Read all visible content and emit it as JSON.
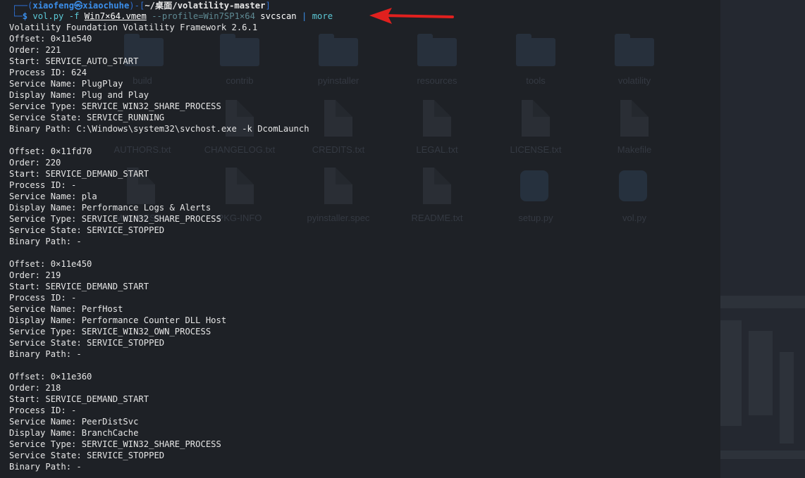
{
  "prompt": {
    "user": "xiaofeng",
    "at_symbol": "㉿",
    "host": "xiaochuhe",
    "path": "~/桌面/volatility-master",
    "symbol": "$",
    "cmd_prog": "vol.py",
    "cmd_flag": "-f",
    "cmd_file": "Win7×64.vmem",
    "cmd_profile": "--profile=Win7SP1×64",
    "cmd_plugin": "svcscan",
    "pipe": "|",
    "pipe_cmd": "more"
  },
  "output": {
    "header": "Volatility Foundation Volatility Framework 2.6.1",
    "services": [
      {
        "offset": "Offset: 0×11e540",
        "order": "Order: 221",
        "start": "Start: SERVICE_AUTO_START",
        "pid": "Process ID: 624",
        "name": "Service Name: PlugPlay",
        "display": "Display Name: Plug and Play",
        "type": "Service Type: SERVICE_WIN32_SHARE_PROCESS",
        "state": "Service State: SERVICE_RUNNING",
        "binary": "Binary Path: C:\\Windows\\system32\\svchost.exe -k DcomLaunch"
      },
      {
        "offset": "Offset: 0×11fd70",
        "order": "Order: 220",
        "start": "Start: SERVICE_DEMAND_START",
        "pid": "Process ID: -",
        "name": "Service Name: pla",
        "display": "Display Name: Performance Logs & Alerts",
        "type": "Service Type: SERVICE_WIN32_SHARE_PROCESS",
        "state": "Service State: SERVICE_STOPPED",
        "binary": "Binary Path: -"
      },
      {
        "offset": "Offset: 0×11e450",
        "order": "Order: 219",
        "start": "Start: SERVICE_DEMAND_START",
        "pid": "Process ID: -",
        "name": "Service Name: PerfHost",
        "display": "Display Name: Performance Counter DLL Host",
        "type": "Service Type: SERVICE_WIN32_OWN_PROCESS",
        "state": "Service State: SERVICE_STOPPED",
        "binary": "Binary Path: -"
      },
      {
        "offset": "Offset: 0×11e360",
        "order": "Order: 218",
        "start": "Start: SERVICE_DEMAND_START",
        "pid": "Process ID: -",
        "name": "Service Name: PeerDistSvc",
        "display": "Display Name: BranchCache",
        "type": "Service Type: SERVICE_WIN32_SHARE_PROCESS",
        "state": "Service State: SERVICE_STOPPED",
        "binary": "Binary Path: -"
      }
    ]
  },
  "desktop": {
    "labels": [
      "build",
      "contrib",
      "pyinstaller",
      "resources",
      "tools",
      "volatility",
      "AUTHORS.txt",
      "CHANGELOG.txt",
      "CREDITS.txt",
      "LEGAL.txt",
      "LICENSE.txt",
      "Makefile",
      "MANIFEST.in",
      "PKG-INFO",
      "pyinstaller.spec",
      "README.txt",
      "setup.py",
      "vol.py"
    ]
  },
  "colors": {
    "background": "#1e2126",
    "prompt_user": "#3b8eea",
    "command": "#5cc9d6",
    "text": "#e6e6e6",
    "arrow": "#e0201e"
  }
}
